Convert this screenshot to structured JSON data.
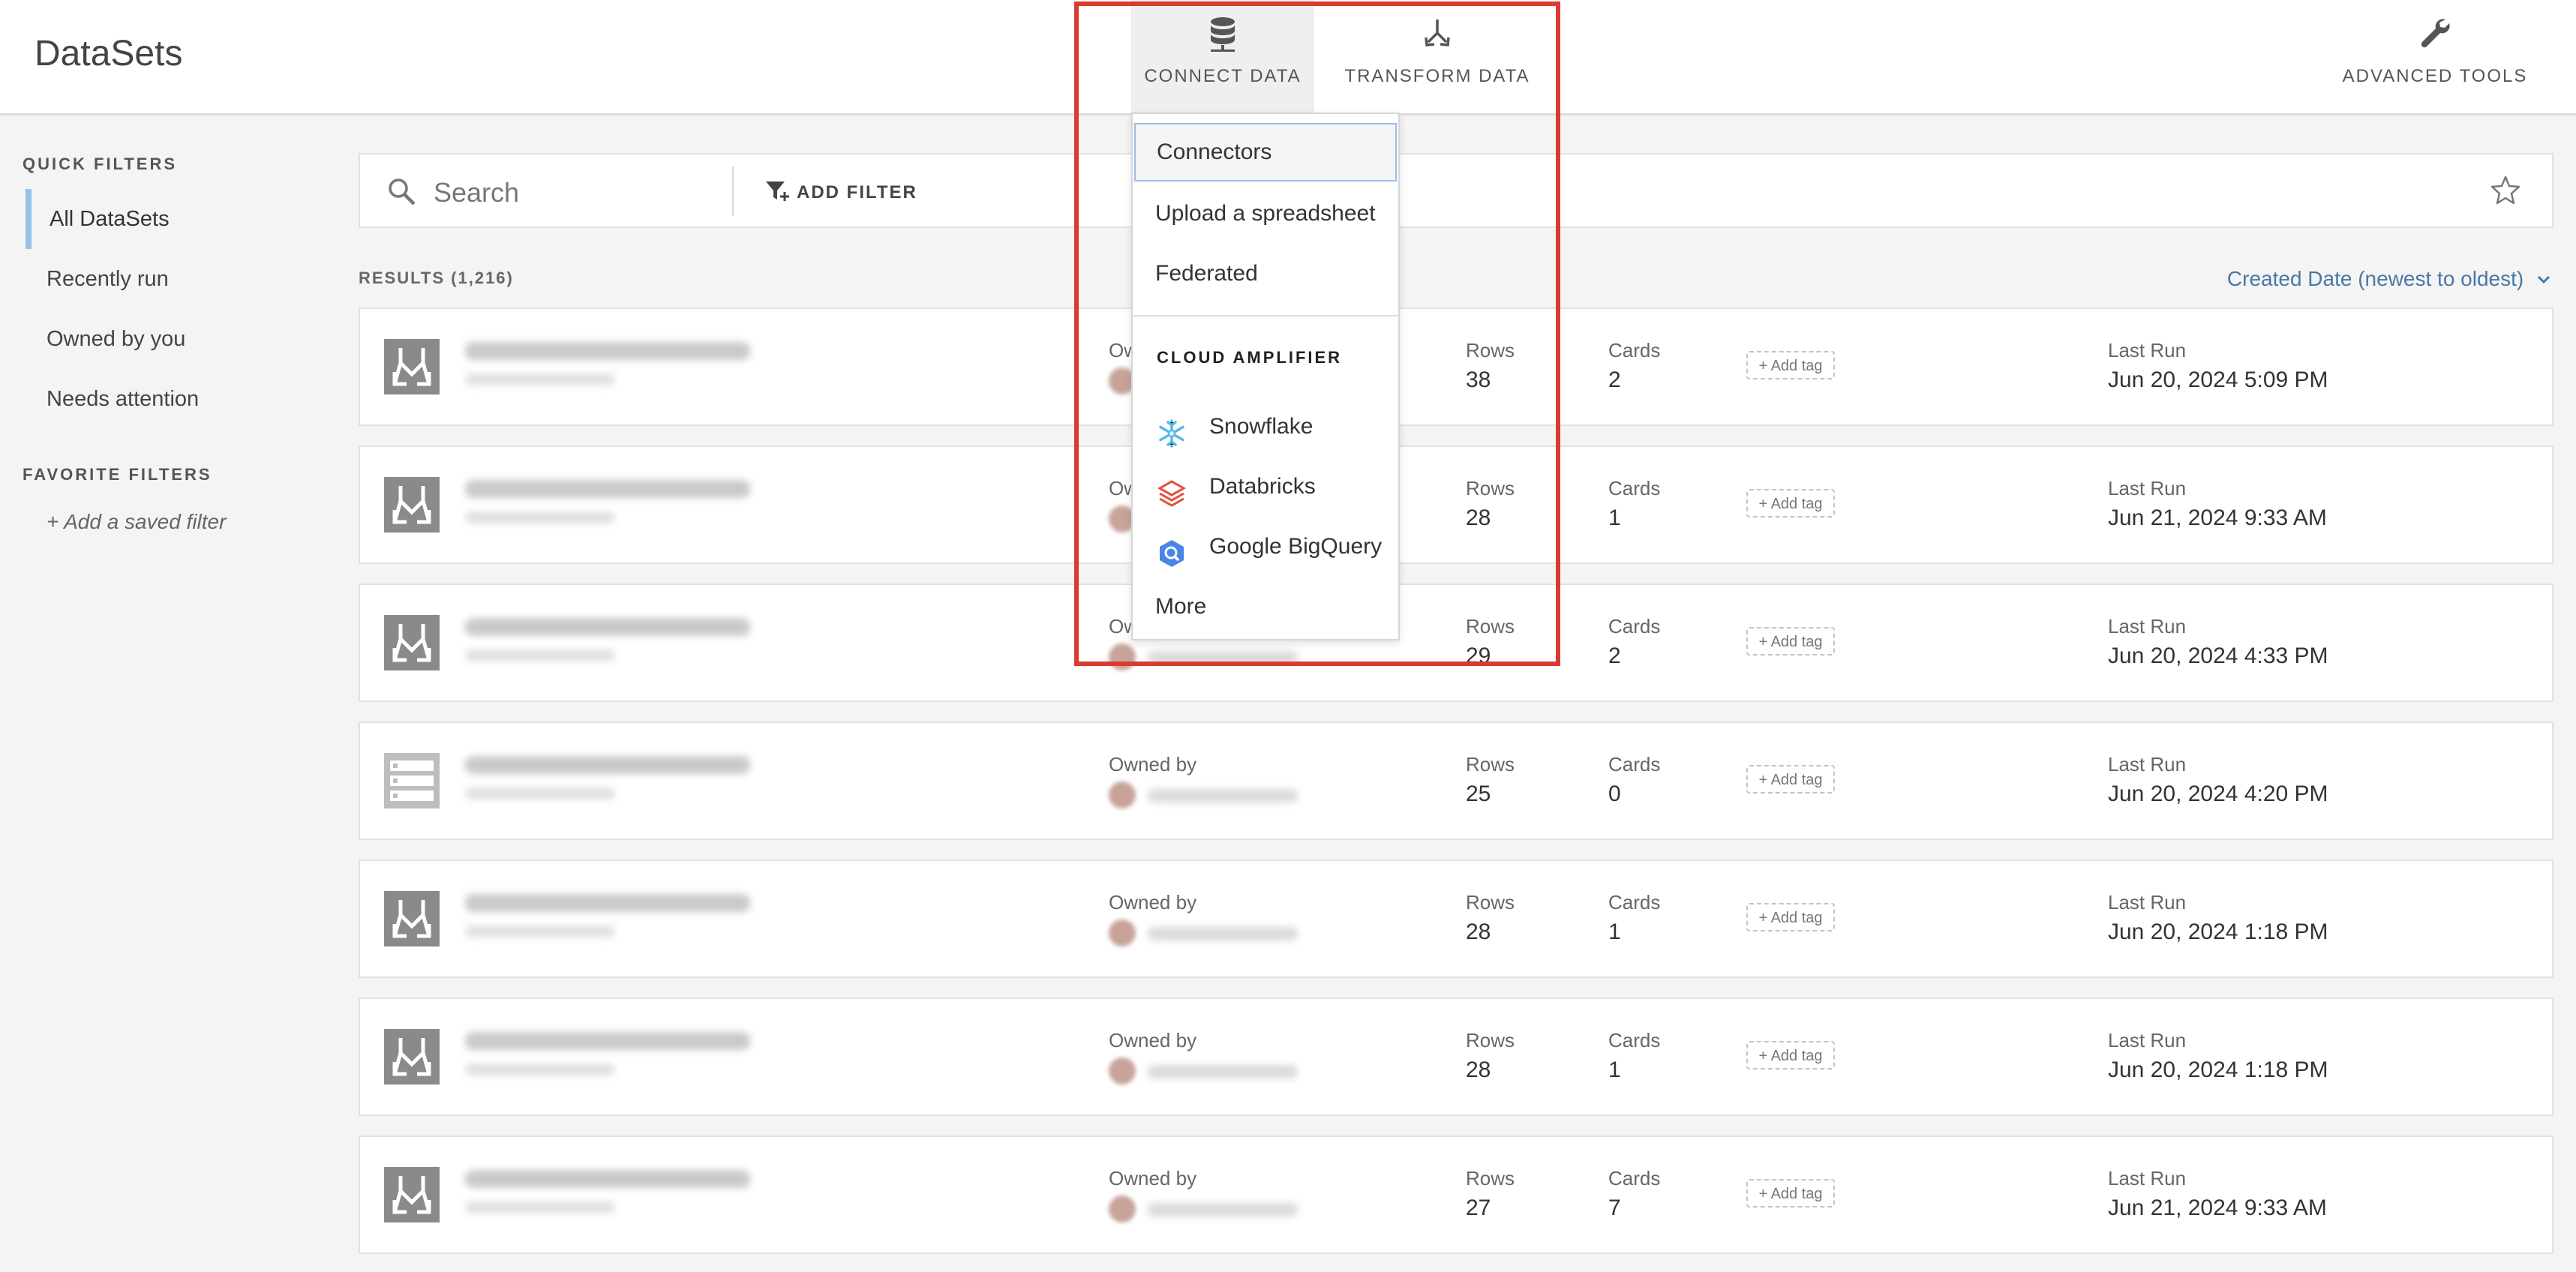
{
  "header": {
    "title": "DataSets",
    "tabs": {
      "connect": {
        "label": "CONNECT DATA",
        "icon": "database-icon"
      },
      "transform": {
        "label": "TRANSFORM DATA",
        "icon": "merge-arrows-icon"
      },
      "advanced": {
        "label": "ADVANCED TOOLS",
        "icon": "wrench-icon"
      }
    }
  },
  "sidebar": {
    "quick_filters_heading": "QUICK FILTERS",
    "quick_filters": [
      {
        "label": "All DataSets",
        "active": true
      },
      {
        "label": "Recently run"
      },
      {
        "label": "Owned by you"
      },
      {
        "label": "Needs attention"
      }
    ],
    "favorite_filters_heading": "FAVORITE FILTERS",
    "add_saved_filter": "+ Add a saved filter"
  },
  "search": {
    "placeholder": "Search",
    "add_filter_label": "ADD FILTER"
  },
  "results": {
    "count_label": "RESULTS (1,216)",
    "sort_label": "Created Date (newest to oldest)"
  },
  "row_labels": {
    "owned_by": "Owned by",
    "rows": "Rows",
    "cards": "Cards",
    "add_tag": "+ Add tag",
    "last_run": "Last Run"
  },
  "rows": [
    {
      "type": "dataflow",
      "rows": "38",
      "cards": "2",
      "last_run": "Jun 20, 2024 5:09 PM"
    },
    {
      "type": "dataflow",
      "rows": "28",
      "cards": "1",
      "last_run": "Jun 21, 2024 9:33 AM"
    },
    {
      "type": "dataflow",
      "rows": "29",
      "cards": "2",
      "last_run": "Jun 20, 2024 4:33 PM"
    },
    {
      "type": "dataset",
      "rows": "25",
      "cards": "0",
      "last_run": "Jun 20, 2024 4:20 PM"
    },
    {
      "type": "dataflow",
      "rows": "28",
      "cards": "1",
      "last_run": "Jun 20, 2024 1:18 PM"
    },
    {
      "type": "dataflow",
      "rows": "28",
      "cards": "1",
      "last_run": "Jun 20, 2024 1:18 PM"
    },
    {
      "type": "dataflow",
      "rows": "27",
      "cards": "7",
      "last_run": "Jun 21, 2024 9:33 AM"
    }
  ],
  "dropdown": {
    "items": [
      "Connectors",
      "Upload a spreadsheet",
      "Federated"
    ],
    "cloud_heading": "CLOUD AMPLIFIER",
    "cloud_items": [
      {
        "label": "Snowflake",
        "icon": "snowflake-icon"
      },
      {
        "label": "Databricks",
        "icon": "databricks-icon"
      },
      {
        "label": "Google BigQuery",
        "icon": "bigquery-icon"
      }
    ],
    "more": "More"
  },
  "colors": {
    "accent_link": "#4a77a6",
    "active_filter_bar": "#99c0e8",
    "highlight_box": "#d93a32",
    "snowflake": "#56b9e8",
    "databricks": "#e0503a",
    "bigquery": "#4a86e8"
  }
}
